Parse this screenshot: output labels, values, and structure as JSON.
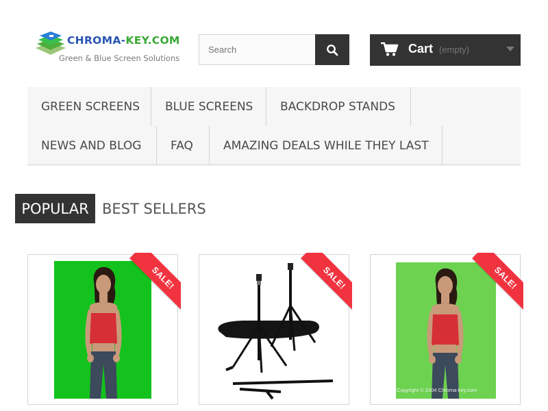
{
  "header": {
    "logo": {
      "title_part1": "CHROMA-",
      "title_part2": "KEY.COM",
      "tagline": "Green & Blue Screen Solutions",
      "icon": "layered-logo-icon"
    },
    "search": {
      "placeholder": "Search",
      "value": "",
      "icon": "search-icon"
    },
    "cart": {
      "label": "Cart",
      "status": "(empty)",
      "icon": "cart-icon",
      "dropdown_icon": "caret-down-icon"
    }
  },
  "menu": {
    "items": [
      {
        "label": "GREEN SCREENS"
      },
      {
        "label": "BLUE SCREENS"
      },
      {
        "label": "BACKDROP STANDS"
      },
      {
        "label": "NEWS AND BLOG"
      },
      {
        "label": "FAQ"
      },
      {
        "label": "AMAZING DEALS WHILE THEY LAST"
      }
    ]
  },
  "tabs": {
    "popular": "POPULAR",
    "best_sellers": "BEST SELLERS",
    "active": "popular"
  },
  "products": [
    {
      "badge": "SALE!",
      "image": "woman-on-green-screen"
    },
    {
      "badge": "SALE!",
      "image": "backdrop-stand-kit"
    },
    {
      "badge": "SALE!",
      "image": "woman-on-green-screen",
      "caption": "Copyright © 2004 Chroma-key.com"
    }
  ],
  "colors": {
    "dark": "#333333",
    "sale_red": "#f13340",
    "brand_blue": "#2a55b3",
    "brand_green": "#3aa935",
    "chroma_green": "#14c21e",
    "chroma_green_light": "#6cd250"
  }
}
